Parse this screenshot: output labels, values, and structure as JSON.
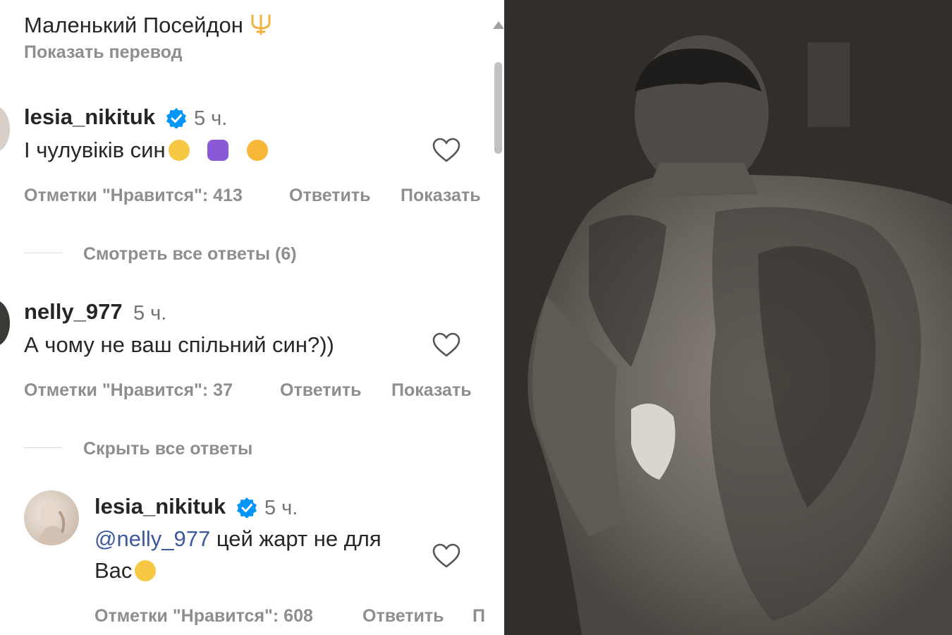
{
  "caption": {
    "text": "Маленький Посейдон",
    "emoji_icon": "trident-emoji",
    "translate": "Показать перевод"
  },
  "comments": [
    {
      "username": "lesia_nikituk",
      "verified": true,
      "time": "5 ч.",
      "text": "І чулувіків син",
      "emojis": [
        "tears-of-joy-emoji",
        "purple-heart-hands-emoji",
        "kiss-wink-emoji"
      ],
      "likes": "Отметки \"Нравится\": 413",
      "reply": "Ответить",
      "show": "Показать",
      "replies_toggle": "Смотреть все ответы (6)"
    },
    {
      "username": "nelly_977",
      "verified": false,
      "time": "5 ч.",
      "text": "А чому не ваш спільний син?))",
      "likes": "Отметки \"Нравится\": 37",
      "reply": "Ответить",
      "show": "Показать",
      "replies_toggle": "Скрыть все ответы"
    }
  ],
  "reply": {
    "username": "lesia_nikituk",
    "verified": true,
    "time": "5 ч.",
    "mention": "@nelly_977",
    "text_line1": " цей жарт не для",
    "text_line2": "Вас",
    "emoji": "tears-of-joy-emoji",
    "likes": "Отметки \"Нравится\": 608",
    "reply": "Ответить",
    "show_truncated": "П"
  },
  "colors": {
    "text": "#262626",
    "meta": "#8e8e8e",
    "verified": "#0095f6",
    "mention": "#3d5a9c"
  }
}
